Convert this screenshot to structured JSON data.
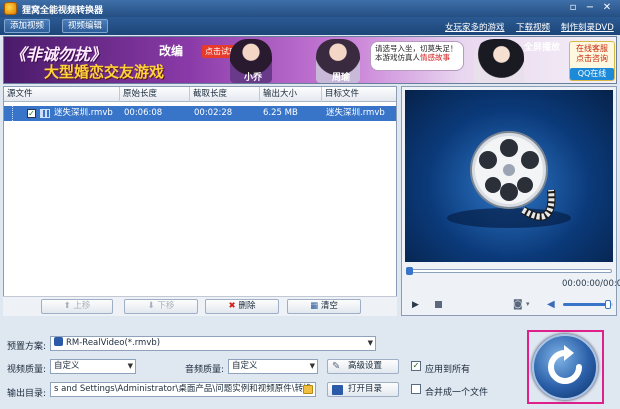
{
  "window": {
    "title": "狸窝全能视频转换器",
    "controls": [
      "minimize",
      "maximize",
      "close"
    ]
  },
  "toolbar": {
    "add_video": "添加视频",
    "edit_video": "视频编辑",
    "links": [
      "女玩家多的游戏",
      "下载视频",
      "制作刻录DVD"
    ]
  },
  "ad": {
    "left_title": "《非诚勿扰》",
    "left_tag": "改编",
    "left_button": "点击试玩",
    "left_subtitle": "大型婚恋交友游戏",
    "char_name_1": "小乔",
    "char_name_2": "周瑜",
    "bubble_text": "请选号入坐，切莫失足！本游戏仿真人",
    "bubble_highlight": "情感故事",
    "online_text": "全屏播放",
    "service_line1": "在线客服",
    "service_line2": "点击咨询",
    "qq_online": "QQ在线"
  },
  "file_list": {
    "columns": [
      "源文件",
      "原始长度",
      "截取长度",
      "输出大小",
      "目标文件"
    ],
    "rows": [
      {
        "source": "迷失深圳.rmvb",
        "original_length": "00:06:08",
        "clip_length": "00:02:28",
        "output_size": "6.25 MB",
        "target": "迷失深圳.rmvb",
        "checked": true
      }
    ],
    "buttons": {
      "up": "上移",
      "down": "下移",
      "delete": "删除",
      "clear": "清空"
    }
  },
  "player": {
    "time": "00:00:00/00:00:00",
    "progress": 0,
    "volume": 0.9
  },
  "settings": {
    "preset_label": "预置方案:",
    "preset_value": "RM-RealVideo(*.rmvb)",
    "video_quality_label": "视频质量:",
    "video_quality_value": "自定义",
    "audio_quality_label": "音频质量:",
    "audio_quality_value": "自定义",
    "advanced_button": "高级设置",
    "apply_all_label": "应用到所有",
    "apply_all_checked": true,
    "output_dir_label": "输出目录:",
    "output_dir_value": "s and Settings\\Administrator\\桌面产品\\问题实例和视频原件\\转换",
    "open_dir_button": "打开目录",
    "merge_label": "合并成一个文件",
    "merge_checked": false
  },
  "colors": {
    "titlebar": "#244f85",
    "selection": "#3875c8",
    "highlight_frame": "#e0208a"
  }
}
